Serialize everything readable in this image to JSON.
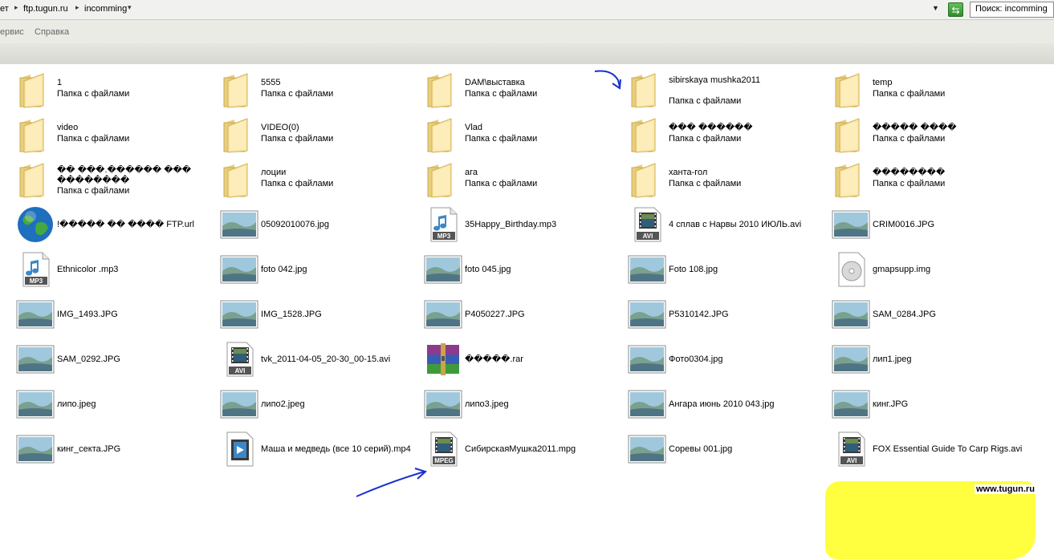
{
  "address_bar": {
    "crumbs": [
      "ет",
      "ftp.tugun.ru",
      "incomming"
    ],
    "search_text": "Поиск: incomming"
  },
  "menu": [
    "ервис",
    "Справка"
  ],
  "folder_type": "Папка с файлами",
  "items": [
    {
      "name": "1",
      "kind": "folder"
    },
    {
      "name": "5555",
      "kind": "folder"
    },
    {
      "name": "DAM\\выставка",
      "kind": "folder"
    },
    {
      "name": "sibirskaya mushka2011",
      "kind": "folder"
    },
    {
      "name": "temp",
      "kind": "folder"
    },
    {
      "name": "video",
      "kind": "folder"
    },
    {
      "name": "VIDEO(0)",
      "kind": "folder"
    },
    {
      "name": "Vlad",
      "kind": "folder"
    },
    {
      "name": "��� ������",
      "kind": "folder"
    },
    {
      "name": "����� ����",
      "kind": "folder"
    },
    {
      "name": "�� ���.������ ��� ��������",
      "kind": "folder"
    },
    {
      "name": "лоции",
      "kind": "folder"
    },
    {
      "name": "ага",
      "kind": "folder"
    },
    {
      "name": "ханта-гол",
      "kind": "folder"
    },
    {
      "name": "��������",
      "kind": "folder"
    },
    {
      "name": "!����� �� ���� FTP.url",
      "kind": "url"
    },
    {
      "name": "05092010076.jpg",
      "kind": "image"
    },
    {
      "name": "35Happy_Birthday.mp3",
      "kind": "mp3"
    },
    {
      "name": "4 сплав с Нарвы 2010 ИЮЛЬ.avi",
      "kind": "avi"
    },
    {
      "name": "CRIM0016.JPG",
      "kind": "image"
    },
    {
      "name": "Ethnicolor .mp3",
      "kind": "mp3"
    },
    {
      "name": "foto 042.jpg",
      "kind": "image"
    },
    {
      "name": "foto 045.jpg",
      "kind": "image"
    },
    {
      "name": "Foto 108.jpg",
      "kind": "image"
    },
    {
      "name": "gmapsupp.img",
      "kind": "disc"
    },
    {
      "name": "IMG_1493.JPG",
      "kind": "image"
    },
    {
      "name": "IMG_1528.JPG",
      "kind": "image"
    },
    {
      "name": "P4050227.JPG",
      "kind": "image"
    },
    {
      "name": "P5310142.JPG",
      "kind": "image"
    },
    {
      "name": "SAM_0284.JPG",
      "kind": "image"
    },
    {
      "name": "SAM_0292.JPG",
      "kind": "image"
    },
    {
      "name": "tvk_2011-04-05_20-30_00-15.avi",
      "kind": "avi"
    },
    {
      "name": "�����.rar",
      "kind": "rar"
    },
    {
      "name": "Фото0304.jpg",
      "kind": "image"
    },
    {
      "name": "лип1.jpeg",
      "kind": "image"
    },
    {
      "name": "липо.jpeg",
      "kind": "image"
    },
    {
      "name": "липо2.jpeg",
      "kind": "image"
    },
    {
      "name": "липо3.jpeg",
      "kind": "image"
    },
    {
      "name": "Ангара июнь 2010 043.jpg",
      "kind": "image"
    },
    {
      "name": "кинг.JPG",
      "kind": "image"
    },
    {
      "name": "кинг_секта.JPG",
      "kind": "image"
    },
    {
      "name": "Маша и медведь (все 10 серий).mp4",
      "kind": "mp4"
    },
    {
      "name": "СибирскаяМушка2011.mpg",
      "kind": "mpeg"
    },
    {
      "name": "Соревы 001.jpg",
      "kind": "image"
    },
    {
      "name": "FOX Essential Guide To Carp Rigs.avi",
      "kind": "avi",
      "highlighted": true
    }
  ],
  "icon_labels": {
    "mp3": "MP3",
    "avi": "AVI",
    "mpeg": "MPEG"
  },
  "colors": {
    "highlight": "#ffff3f",
    "annotation_arrow": "#1b2fcf"
  },
  "watermark": "www.tugun.ru"
}
